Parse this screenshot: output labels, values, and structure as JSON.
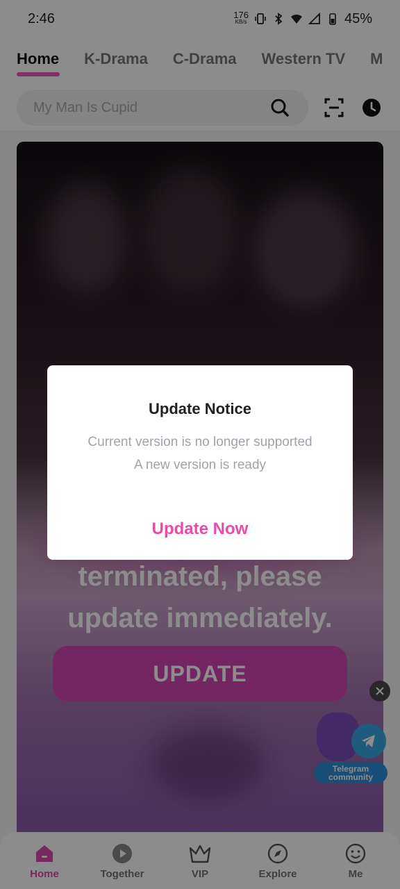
{
  "status_bar": {
    "time": "2:46",
    "net_speed_value": "176",
    "net_speed_unit": "KB/s",
    "battery": "45%"
  },
  "top_nav": {
    "tabs": [
      {
        "label": "Home",
        "active": true
      },
      {
        "label": "K-Drama"
      },
      {
        "label": "C-Drama"
      },
      {
        "label": "Western TV"
      },
      {
        "label": "M"
      }
    ],
    "search_placeholder": "My Man Is Cupid"
  },
  "banner": {
    "line1": "terminated, please",
    "line2": "update immediately.",
    "button_label": "UPDATE"
  },
  "telegram": {
    "label_line1": "Telegram",
    "label_line2": "community"
  },
  "dialog": {
    "title": "Update Notice",
    "message_line1": "Current version is no longer supported",
    "message_line2": "A new version is ready",
    "action_label": "Update Now"
  },
  "bottom_nav": {
    "items": [
      {
        "label": "Home",
        "icon": "home-icon",
        "active": true
      },
      {
        "label": "Together",
        "icon": "together-icon"
      },
      {
        "label": "VIP",
        "icon": "crown-icon"
      },
      {
        "label": "Explore",
        "icon": "compass-icon"
      },
      {
        "label": "Me",
        "icon": "smiley-icon"
      }
    ]
  },
  "colors": {
    "accent": "#e64ca8",
    "update_button": "#d446b4",
    "telegram": "#3aa6e0"
  }
}
